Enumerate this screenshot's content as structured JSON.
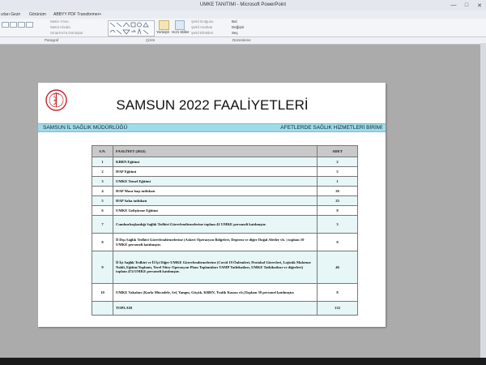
{
  "window": {
    "title": "UMKE TANITIMI  -  Microsoft PowerPoint"
  },
  "tabs": [
    "ızları Gezir",
    "Görünüm",
    "ABBYY PDF Transformer+"
  ],
  "ribbon": {
    "items": [
      "Metin Yönü",
      "Metni Hizala",
      "SmartArt'a Dönüştür",
      "Yerleştir",
      "Hızlı Stiller",
      "Şekil Dolgusu",
      "Şekil Anahatı",
      "Şekil Efektleri",
      "Bul",
      "Değiştir",
      "Seç"
    ],
    "groups": [
      "Paragraf",
      "Çizim",
      "Düzenleme"
    ]
  },
  "slide": {
    "title": "SAMSUN 2022 FAALİYETLERİ",
    "band_left": "SAMSUN İL SAĞLIK MÜDÜRLÜĞÜ",
    "band_right": "AFETLERDE SAĞLIK HİZMETLERİ BİRİMİ",
    "table": {
      "headers": [
        "S.N.",
        "FAALİYET  (2022)",
        "ADET"
      ],
      "rows": [
        {
          "sn": "1",
          "activity": "KBRN Eğitimi",
          "count": "2"
        },
        {
          "sn": "2",
          "activity": "HAP Eğitimi",
          "count": "5"
        },
        {
          "sn": "3",
          "activity": "UMKE   Temel Eğitimi",
          "count": "1"
        },
        {
          "sn": "4",
          "activity": "HAP Masa başı tatbikatı",
          "count": "26"
        },
        {
          "sn": "5",
          "activity": "HAP Saha tatbikatı",
          "count": "25"
        },
        {
          "sn": "6",
          "activity": "UMKE   Geliştirme Eğitimi",
          "count": "8"
        },
        {
          "sn": "7",
          "activity": "Cumhurbaşkanlığı Sağlık Tedbiri Görevlendirmelerine toplam 42 UMKE personeli katılmıştır.",
          "count": "3"
        },
        {
          "sn": "8",
          "activity": "İl Dışı Sağlık Tedbiri Görevlendirmelerine (Askeri Operasyon Bölgeleri, Deprem ve diğer Doğal Afetler vb.  )    toplam  10 UMKE  personeli katılmıştır.",
          "count": "8"
        },
        {
          "sn": "9",
          "activity": "İl İçi Sağlık Tedbiri ve İl İçi Diğer UMKE Görevlendirmelerine (Covid 19 Önlemleri, Protokol Görevleri, Lojistik Malzeme Nakli, Eğitim/Toplantı, Yerel Nitey Operasyon Planı Toplantıları TAMP Tatbikatları, UMKE Tatbikatları ve diğerleri)  toplam 474 UMKE  personeli katılmıştır.",
          "count": "46"
        },
        {
          "sn": "10",
          "activity": "UMKE Vakaları   (Karla  Mücadele,  Sel,  Yangın,  Göçük,  KBRN,  Trafik  Kazası vb.)Toplam  39 personel katılmıştır.",
          "count": "8"
        },
        {
          "sn": "",
          "activity": "TOPLAM",
          "count": "132"
        }
      ]
    }
  }
}
